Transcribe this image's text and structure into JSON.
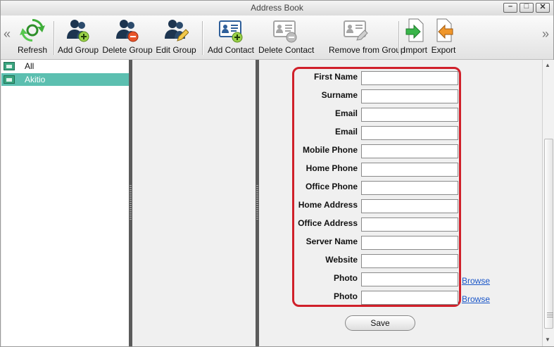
{
  "window": {
    "title": "Address Book"
  },
  "toolbar": {
    "scroll_left": "«",
    "scroll_right": "»",
    "buttons": [
      {
        "label": "Refresh",
        "icon": "refresh-icon"
      },
      {
        "label": "Add Group",
        "icon": "add-group-icon"
      },
      {
        "label": "Delete Group",
        "icon": "delete-group-icon"
      },
      {
        "label": "Edit Group",
        "icon": "edit-group-icon"
      },
      {
        "label": "Add Contact",
        "icon": "add-contact-icon"
      },
      {
        "label": "Delete Contact",
        "icon": "delete-contact-icon"
      },
      {
        "label": "Remove from Group",
        "icon": "remove-from-group-icon"
      },
      {
        "label": "Import",
        "icon": "import-icon"
      },
      {
        "label": "Export",
        "icon": "export-icon"
      }
    ]
  },
  "groups": [
    {
      "label": "All",
      "selected": false
    },
    {
      "label": "Akitio",
      "selected": true
    }
  ],
  "form": {
    "fields": [
      {
        "label": "First Name",
        "value": ""
      },
      {
        "label": "Surname",
        "value": ""
      },
      {
        "label": "Email",
        "value": ""
      },
      {
        "label": "Email",
        "value": ""
      },
      {
        "label": "Mobile Phone",
        "value": ""
      },
      {
        "label": "Home Phone",
        "value": ""
      },
      {
        "label": "Office Phone",
        "value": ""
      },
      {
        "label": "Home Address",
        "value": ""
      },
      {
        "label": "Office Address",
        "value": ""
      },
      {
        "label": "Server Name",
        "value": ""
      },
      {
        "label": "Website",
        "value": ""
      },
      {
        "label": "Photo",
        "value": ""
      },
      {
        "label": "Photo",
        "value": ""
      }
    ],
    "browse_label": "Browse",
    "save_label": "Save"
  },
  "colors": {
    "highlight_border": "#d0202a",
    "selection": "#5cbfb0",
    "link": "#1a56c8"
  }
}
